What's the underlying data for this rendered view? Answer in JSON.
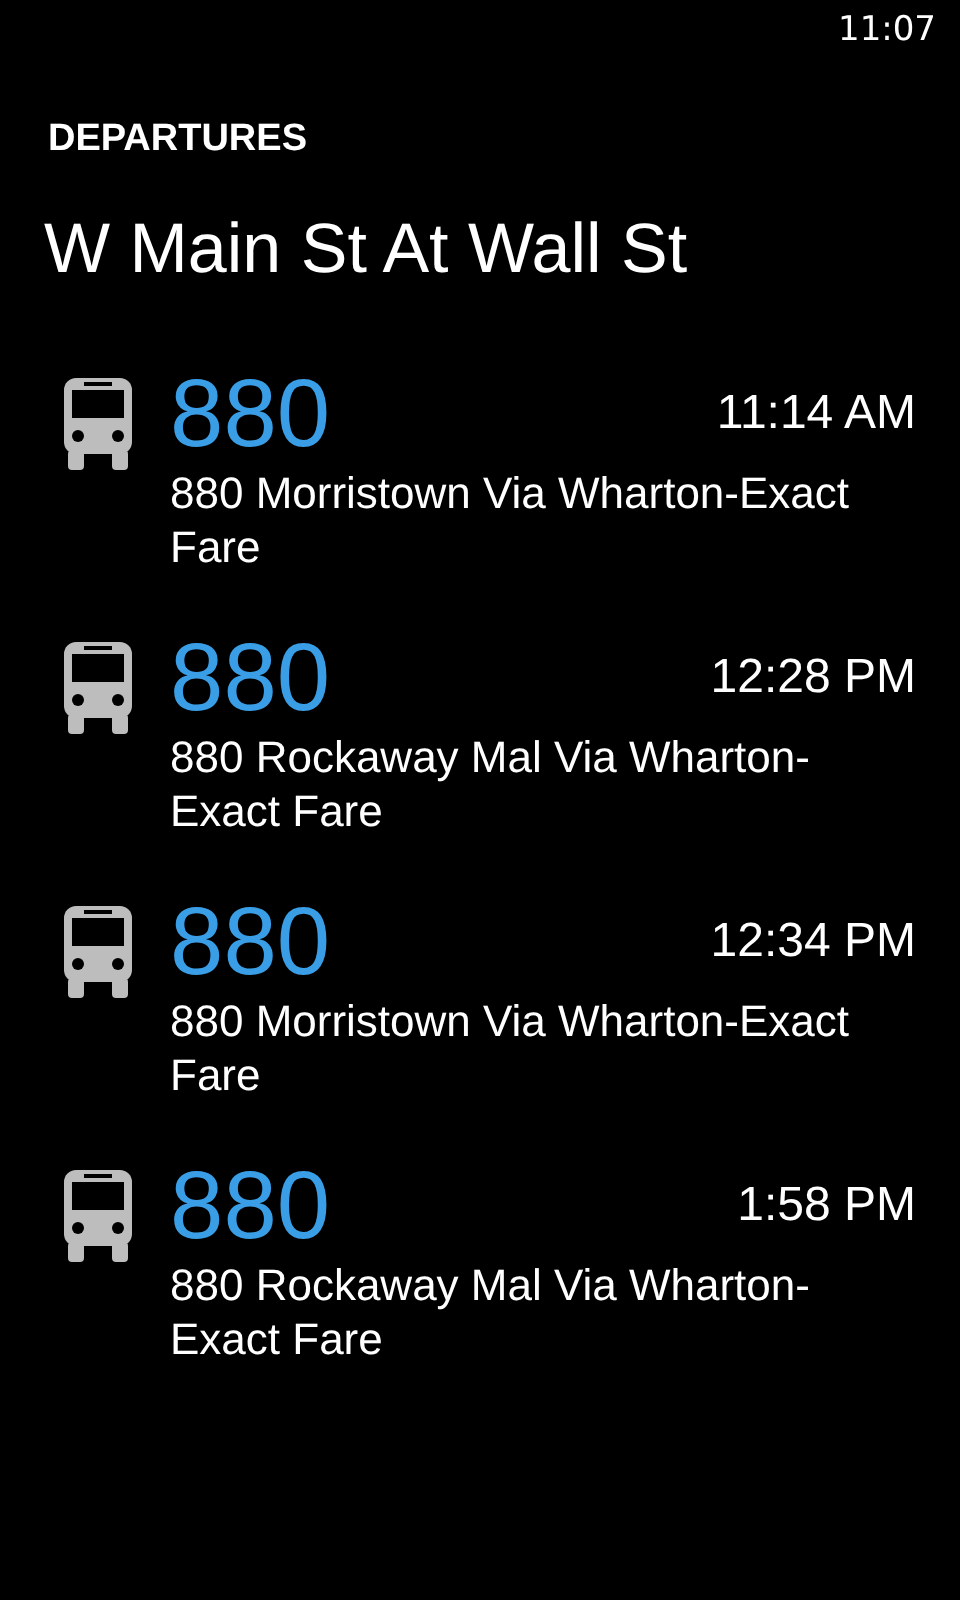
{
  "status_bar": {
    "time": "11:07"
  },
  "header": {
    "app_title": "DEPARTURES",
    "stop_name": "W Main St At Wall St"
  },
  "departures": [
    {
      "route": "880",
      "time": "11:14 AM",
      "description": "880 Morristown Via Wharton-Exact Fare"
    },
    {
      "route": "880",
      "time": "12:28 PM",
      "description": "880 Rockaway Mal Via Wharton-Exact Fare"
    },
    {
      "route": "880",
      "time": "12:34 PM",
      "description": "880 Morristown Via Wharton-Exact Fare"
    },
    {
      "route": "880",
      "time": "1:58 PM",
      "description": "880 Rockaway Mal Via Wharton-Exact Fare"
    }
  ]
}
